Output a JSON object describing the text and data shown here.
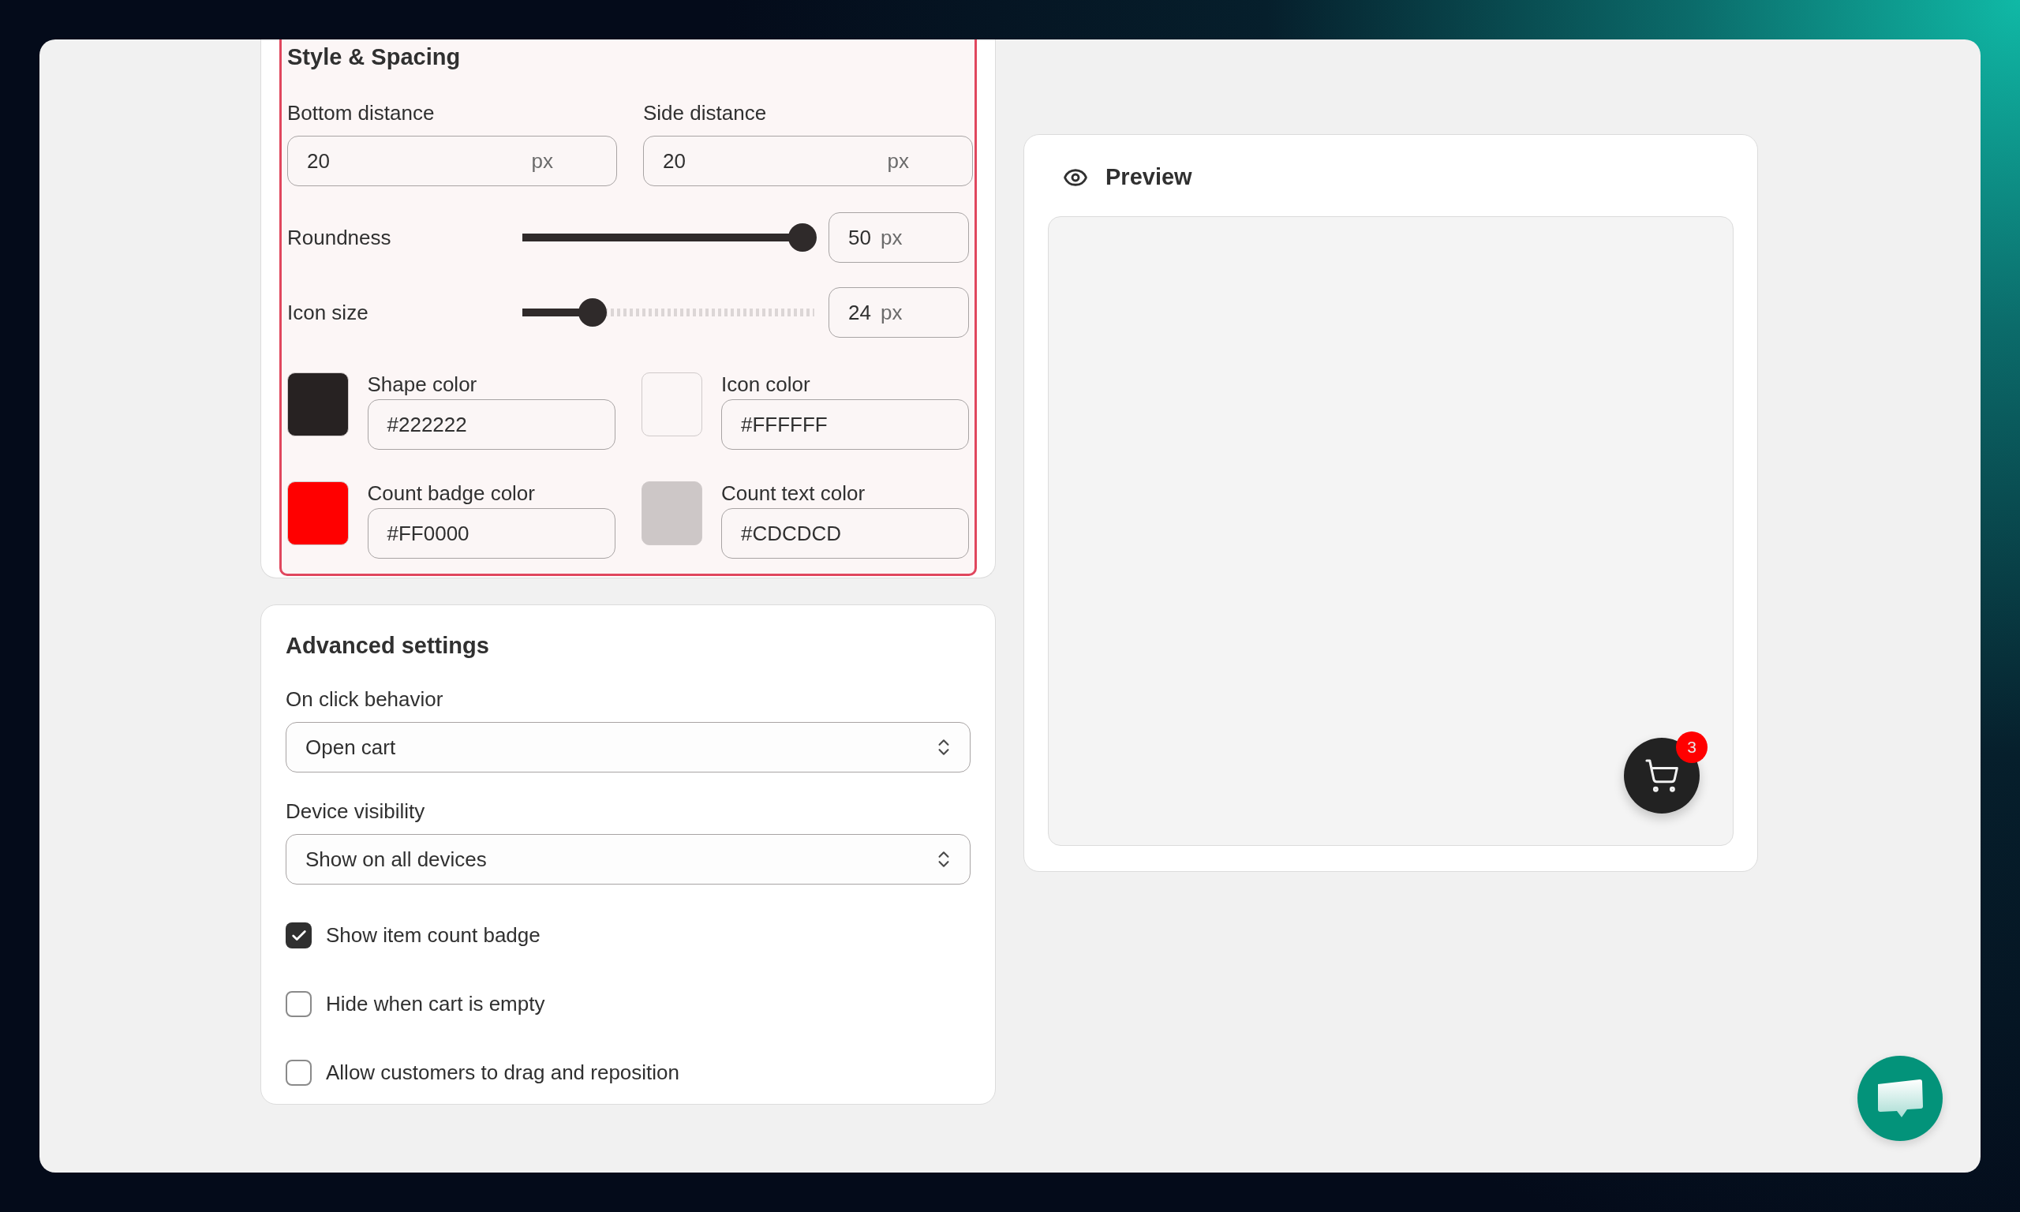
{
  "style_spacing": {
    "title": "Style & Spacing",
    "highlighted": true,
    "distance_fields": [
      {
        "label": "Bottom distance",
        "value": "20",
        "unit": "px"
      },
      {
        "label": "Side distance",
        "value": "20",
        "unit": "px"
      }
    ],
    "sliders": [
      {
        "label": "Roundness",
        "level": 1.0,
        "value": "50",
        "unit": "px"
      },
      {
        "label": "Icon size",
        "level": 0.21,
        "value": "24",
        "unit": "px"
      }
    ],
    "colors": [
      {
        "label": "Shape color",
        "value": "#222222",
        "color": "#272222"
      },
      {
        "label": "Icon color",
        "value": "#FFFFFF",
        "color": "#fbf6f6"
      },
      {
        "label": "Count badge color",
        "value": "#FF0000",
        "color": "#ff0000"
      },
      {
        "label": "Count text color",
        "value": "#CDCDCD",
        "color": "#cdc7c7"
      }
    ]
  },
  "advanced_settings": {
    "title": "Advanced settings",
    "selects": [
      {
        "label": "On click behavior",
        "value": "Open cart"
      },
      {
        "label": "Device visibility",
        "value": "Show on all devices"
      }
    ],
    "checkboxes": [
      {
        "label": "Show item count badge",
        "checked": true
      },
      {
        "label": "Hide when cart is empty",
        "checked": false
      },
      {
        "label": "Allow customers to drag and reposition",
        "checked": false
      }
    ]
  },
  "preview": {
    "title": "Preview",
    "cart_count": "3"
  }
}
